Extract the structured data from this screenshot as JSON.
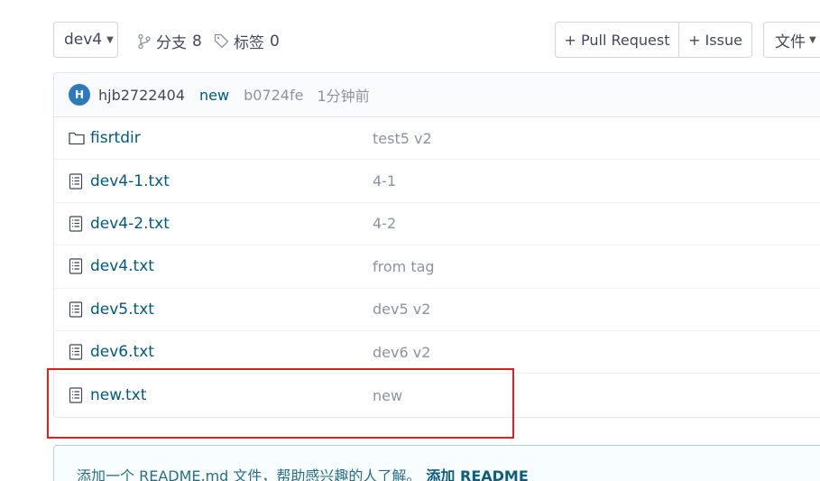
{
  "toolbar": {
    "branch": "dev4",
    "branches_label": "分支",
    "branches_count": "8",
    "tags_label": "标签",
    "tags_count": "0",
    "pull_request": "+ Pull Request",
    "issue": "+ Issue",
    "file_menu": "文件"
  },
  "commit": {
    "avatar_letter": "H",
    "author": "hjb2722404",
    "message": "new",
    "sha": "b0724fe",
    "time": "1分钟前"
  },
  "files": [
    {
      "type": "folder",
      "name": "fisrtdir",
      "commit_message": "test5 v2"
    },
    {
      "type": "file",
      "name": "dev4-1.txt",
      "commit_message": "4-1"
    },
    {
      "type": "file",
      "name": "dev4-2.txt",
      "commit_message": "4-2"
    },
    {
      "type": "file",
      "name": "dev4.txt",
      "commit_message": "from tag"
    },
    {
      "type": "file",
      "name": "dev5.txt",
      "commit_message": "dev5 v2"
    },
    {
      "type": "file",
      "name": "dev6.txt",
      "commit_message": "dev6 v2"
    },
    {
      "type": "file",
      "name": "new.txt",
      "commit_message": "new"
    }
  ],
  "readme": {
    "text": "添加一个 README.md 文件，帮助感兴趣的人了解。",
    "link": "添加 README"
  },
  "colors": {
    "link": "#005980",
    "muted": "#8c92a4",
    "highlight": "#e02020",
    "avatar": "#2d7abf"
  }
}
